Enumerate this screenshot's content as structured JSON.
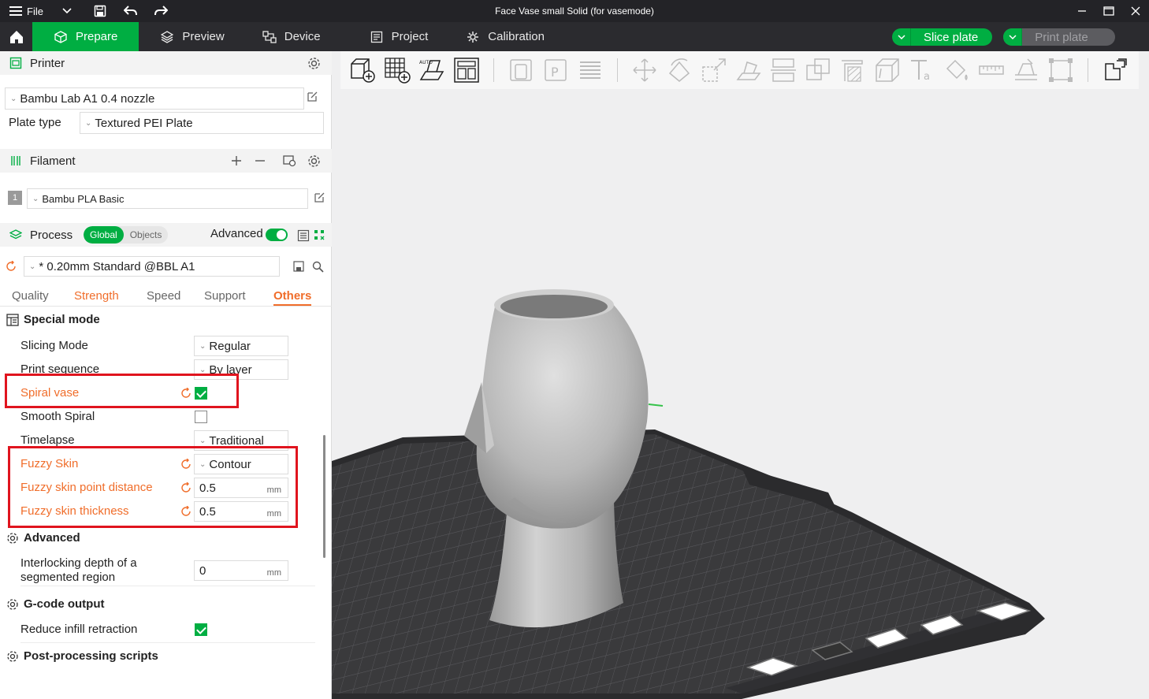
{
  "window": {
    "title": "Face Vase small Solid (for vasemode)",
    "file_menu": "File"
  },
  "tabs": [
    {
      "label": "Prepare",
      "icon": "cube-icon"
    },
    {
      "label": "Preview",
      "icon": "layers-icon"
    },
    {
      "label": "Device",
      "icon": "device-icon"
    },
    {
      "label": "Project",
      "icon": "project-icon"
    },
    {
      "label": "Calibration",
      "icon": "calibration-icon"
    }
  ],
  "actions": {
    "slice_plate": "Slice plate",
    "print_plate": "Print plate"
  },
  "printer": {
    "section_title": "Printer",
    "selected": "Bambu Lab A1 0.4 nozzle",
    "plate_type_label": "Plate type",
    "plate_type": "Textured PEI Plate"
  },
  "filament": {
    "section_title": "Filament",
    "slot_number": "1",
    "selected": "Bambu PLA Basic"
  },
  "process": {
    "section_title": "Process",
    "scope_global": "Global",
    "scope_objects": "Objects",
    "advanced_label": "Advanced",
    "preset": "* 0.20mm Standard @BBL A1",
    "tabs": [
      "Quality",
      "Strength",
      "Speed",
      "Support",
      "Others"
    ]
  },
  "settings": {
    "special_mode_title": "Special mode",
    "slicing_mode_label": "Slicing Mode",
    "slicing_mode_value": "Regular",
    "print_sequence_label": "Print sequence",
    "print_sequence_value": "By layer",
    "spiral_vase_label": "Spiral vase",
    "spiral_vase_checked": true,
    "smooth_spiral_label": "Smooth Spiral",
    "smooth_spiral_checked": false,
    "timelapse_label": "Timelapse",
    "timelapse_value": "Traditional",
    "fuzzy_skin_label": "Fuzzy Skin",
    "fuzzy_skin_value": "Contour",
    "fuzzy_point_distance_label": "Fuzzy skin point distance",
    "fuzzy_point_distance_value": "0.5",
    "fuzzy_thickness_label": "Fuzzy skin thickness",
    "fuzzy_thickness_value": "0.5",
    "unit_mm": "mm",
    "advanced_title": "Advanced",
    "interlocking_label_1": "Interlocking depth of a",
    "interlocking_label_2": "segmented region",
    "interlocking_value": "0",
    "gcode_title": "G-code output",
    "reduce_infill_label": "Reduce infill retraction",
    "reduce_infill_checked": true,
    "post_processing_title": "Post-processing scripts"
  },
  "colors": {
    "accent_green": "#00ae42",
    "highlight_orange": "#f06d2a",
    "annotation_red": "#e0141e"
  }
}
